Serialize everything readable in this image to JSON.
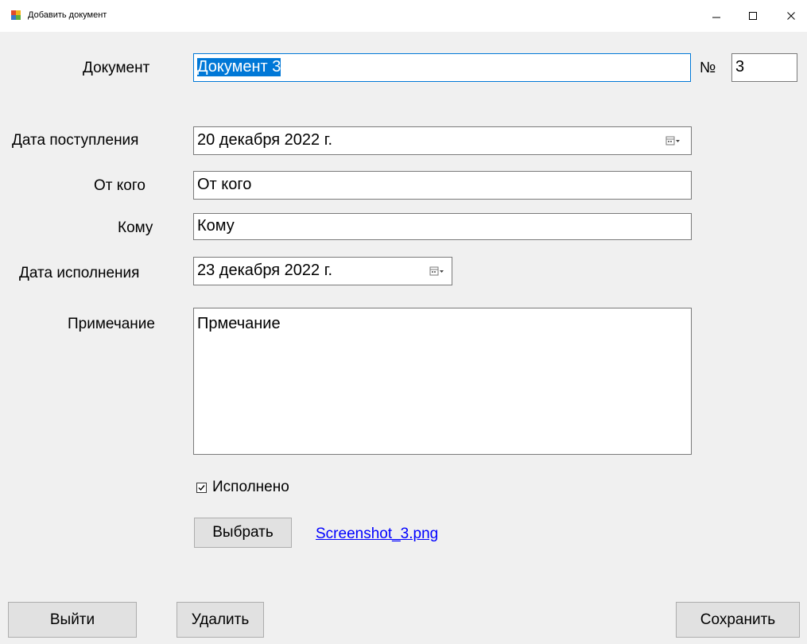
{
  "window": {
    "title": "Добавить документ"
  },
  "form": {
    "document_label": "Документ",
    "document_value": "Документ 3",
    "number_label": "№",
    "number_value": "3",
    "received_date_label": "Дата поступления",
    "received_date_value": "20  декабря  2022 г.",
    "from_label": "От кого",
    "from_value": "От кого",
    "to_label": "Кому",
    "to_value": "Кому",
    "due_date_label": "Дата исполнения",
    "due_date_value": "23  декабря  2022 г.",
    "note_label": "Примечание",
    "note_value": "Прмечание",
    "done_label": "Исполнено",
    "done_checked": true,
    "choose_button": "Выбрать",
    "file_link": "Screenshot_3.png"
  },
  "footer": {
    "exit_button": "Выйти",
    "delete_button": "Удалить",
    "save_button": "Сохранить"
  },
  "icons": {
    "app": "app-form-icon",
    "calendar": "calendar-dropdown-icon",
    "checkbox": "checkmark-icon"
  },
  "colors": {
    "selection": "#0078d7",
    "link": "#0000ff",
    "window_bg": "#f0f0f0"
  }
}
